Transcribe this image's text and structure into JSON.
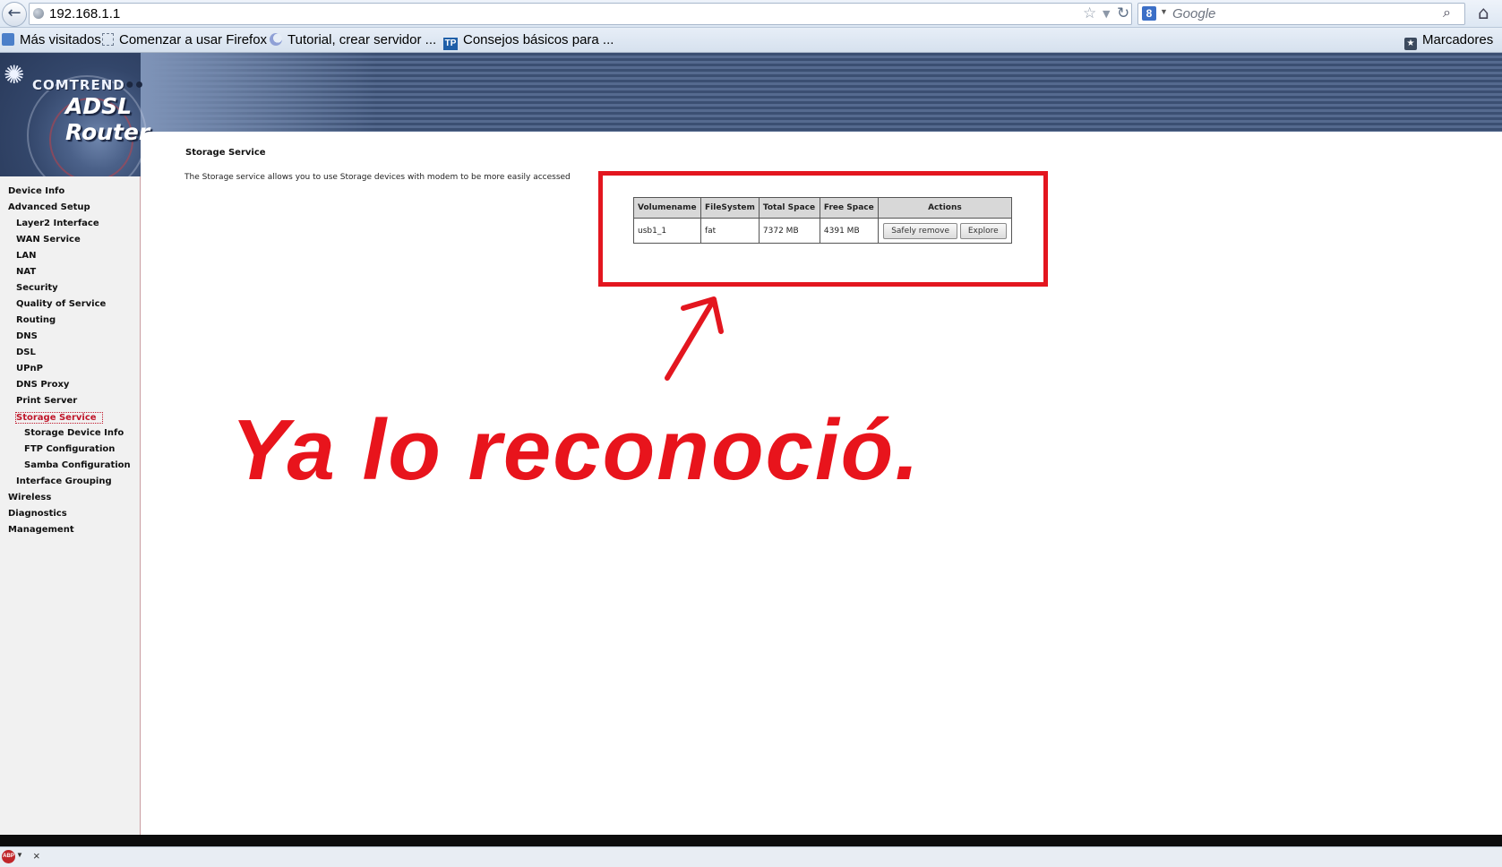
{
  "browser": {
    "url": "192.168.1.1",
    "search_placeholder": "Google",
    "bookmarks": [
      "Más visitados",
      "Comenzar a usar Firefox",
      "Tutorial, crear servidor ...",
      "Consejos básicos para ..."
    ],
    "bookmarks_menu": "Marcadores"
  },
  "router": {
    "brand": "COMTREND",
    "title": "ADSL Router"
  },
  "sidebar": {
    "items": [
      {
        "label": "Device Info"
      },
      {
        "label": "Advanced Setup"
      },
      {
        "label": "Layer2 Interface"
      },
      {
        "label": "WAN Service"
      },
      {
        "label": "LAN"
      },
      {
        "label": "NAT"
      },
      {
        "label": "Security"
      },
      {
        "label": "Quality of Service"
      },
      {
        "label": "Routing"
      },
      {
        "label": "DNS"
      },
      {
        "label": "DSL"
      },
      {
        "label": "UPnP"
      },
      {
        "label": "DNS Proxy"
      },
      {
        "label": "Print Server"
      },
      {
        "label": "Storage Service"
      },
      {
        "label": "Storage Device Info"
      },
      {
        "label": "FTP Configuration"
      },
      {
        "label": "Samba Configuration"
      },
      {
        "label": "Interface Grouping"
      },
      {
        "label": "Wireless"
      },
      {
        "label": "Diagnostics"
      },
      {
        "label": "Management"
      }
    ],
    "active_item": "Storage Service"
  },
  "main": {
    "title": "Storage Service",
    "description": "The Storage service allows you to use Storage devices with modem to be more easily accessed",
    "table": {
      "headers": [
        "Volumename",
        "FileSystem",
        "Total Space",
        "Free Space",
        "Actions"
      ],
      "rows": [
        {
          "volumename": "usb1_1",
          "filesystem": "fat",
          "total_space": "7372 MB",
          "free_space": "4391 MB"
        }
      ],
      "buttons": {
        "safely_remove": "Safely remove",
        "explore": "Explore"
      }
    }
  },
  "annotation": {
    "text": "Ya lo reconoció.",
    "color": "#e8141c"
  },
  "addon_bar": {
    "abp_label": "ABP",
    "close": "×"
  }
}
